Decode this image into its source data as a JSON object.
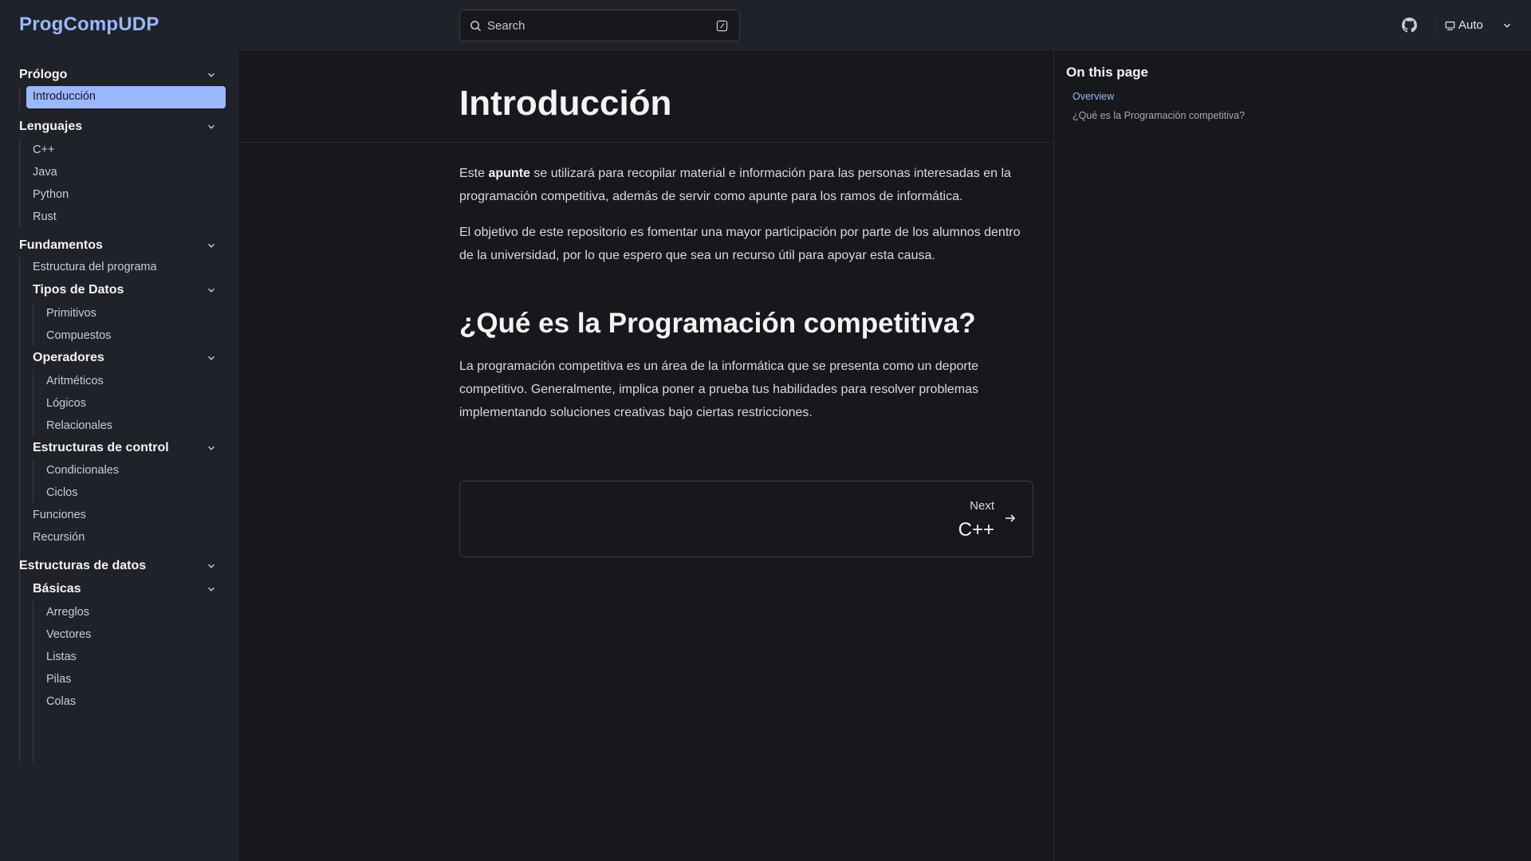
{
  "header": {
    "brand": "ProgCompUDP",
    "search_placeholder": "Search",
    "theme_label": "Auto"
  },
  "sidebar": {
    "prologo": "Prólogo",
    "introduccion": "Introducción",
    "lenguajes": "Lenguajes",
    "lang_items": [
      "C++",
      "Java",
      "Python",
      "Rust"
    ],
    "fundamentos": "Fundamentos",
    "estructura_programa": "Estructura del programa",
    "tipos_datos": "Tipos de Datos",
    "tipos_items": [
      "Primitivos",
      "Compuestos"
    ],
    "operadores": "Operadores",
    "operadores_items": [
      "Aritméticos",
      "Lógicos",
      "Relacionales"
    ],
    "estructuras_control": "Estructuras de control",
    "control_items": [
      "Condicionales",
      "Ciclos"
    ],
    "funciones": "Funciones",
    "recursion": "Recursión",
    "estructuras_datos": "Estructuras de datos",
    "basicas": "Básicas",
    "basicas_items": [
      "Arreglos",
      "Vectores",
      "Listas",
      "Pilas",
      "Colas"
    ]
  },
  "main": {
    "title": "Introducción",
    "p1_pre": "Este ",
    "p1_bold": "apunte",
    "p1_post": " se utilizará para recopilar material e información para las personas interesadas en la programación competitiva, además de servir como apunte para los ramos de informática.",
    "p2": "El objetivo de este repositorio es fomentar una mayor participación por parte de los alumnos dentro de la universidad, por lo que espero que sea un recurso útil para apoyar esta causa.",
    "h2": "¿Qué es la Programación competitiva?",
    "p3": "La programación competitiva es un área de la informática que se presenta como un deporte competitivo. Generalmente, implica poner a prueba tus habilidades para resolver problemas implementando soluciones creativas bajo ciertas restricciones.",
    "next_label": "Next",
    "next_title": "C++"
  },
  "toc": {
    "title": "On this page",
    "items": [
      "Overview",
      "¿Qué es la Programación competitiva?"
    ]
  },
  "colors": {
    "accent": "#9ab8ff",
    "background": "#17181c",
    "sidebar_bg": "#202229"
  }
}
